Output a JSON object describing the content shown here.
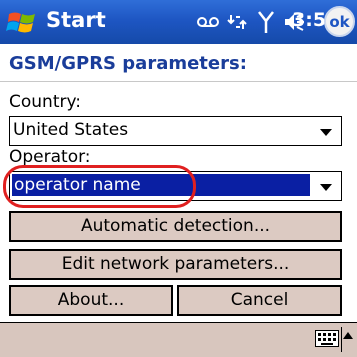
{
  "titlebar": {
    "title": "Start",
    "time": "3:52",
    "ok_label": "ok"
  },
  "header": {
    "title": "GSM/GPRS parameters:"
  },
  "form": {
    "country_label": "Country:",
    "country_value": "United States",
    "operator_label": "Operator:",
    "operator_value": "operator name"
  },
  "buttons": {
    "auto_detect": "Automatic detection...",
    "edit_network": "Edit network parameters...",
    "about": "About...",
    "cancel": "Cancel"
  },
  "colors": {
    "titlebar": "#1e56c3",
    "header_text": "#1a3d9a",
    "selection": "#0a1fa3",
    "button_face": "#dccac2",
    "highlight": "#e02020"
  }
}
